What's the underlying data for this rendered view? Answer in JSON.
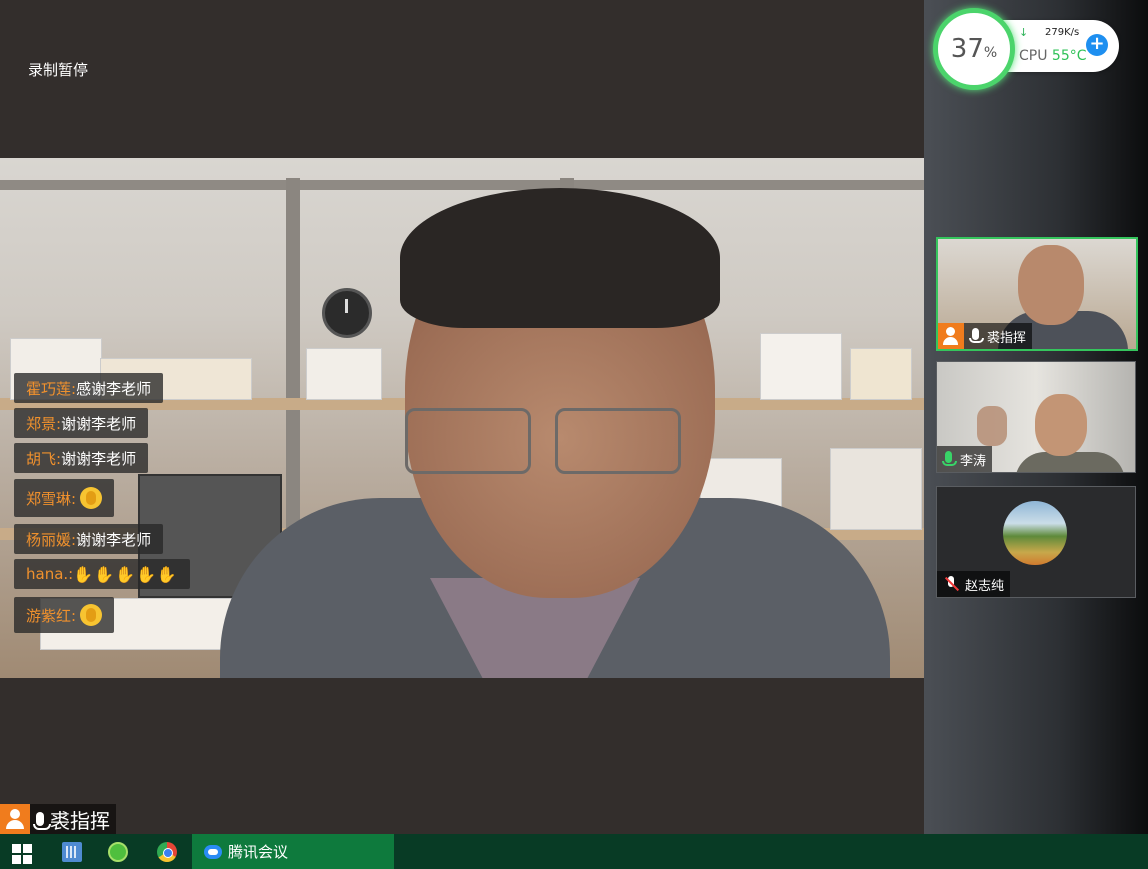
{
  "main": {
    "recording_status": "录制暂停",
    "active_speaker": "裘指挥"
  },
  "chat": [
    {
      "name": "霍巧莲:",
      "text": "感谢李老师"
    },
    {
      "name": "郑景:",
      "text": "谢谢李老师"
    },
    {
      "name": "胡飞:",
      "text": "谢谢李老师"
    },
    {
      "name": "郑雪琳:",
      "text": "",
      "emoji": "clap"
    },
    {
      "name": "杨丽媛:",
      "text": "谢谢李老师"
    },
    {
      "name": "hana.:",
      "text": "",
      "emoji": "wave-hands"
    },
    {
      "name": "游紫红:",
      "text": "",
      "emoji": "clap"
    }
  ],
  "system_widget": {
    "cpu_usage": "37",
    "cpu_usage_unit": "%",
    "network_speed": "279K/s",
    "cpu_label": "CPU",
    "cpu_temp": "55°C"
  },
  "participants": [
    {
      "name": "裘指挥",
      "mic": "on",
      "host": true
    },
    {
      "name": "李涛",
      "mic": "on-green",
      "host": false
    },
    {
      "name": "赵志纯",
      "mic": "muted",
      "host": false
    }
  ],
  "taskbar": {
    "app_label": "腾讯会议"
  },
  "colors": {
    "chat_name": "#f0912d",
    "active_border": "#35c55d",
    "taskbar": "#083b25",
    "taskbar_app": "#0e7a3d",
    "host_badge": "#f07c1d"
  }
}
